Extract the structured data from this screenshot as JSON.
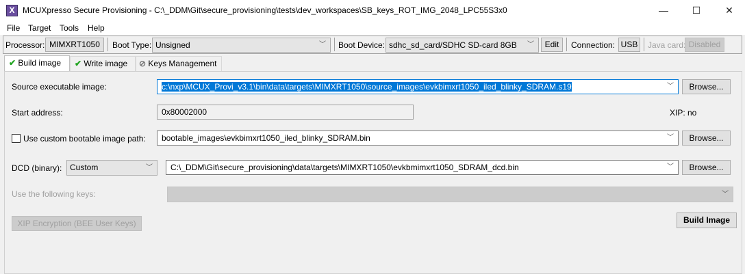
{
  "window": {
    "title": "MCUXpresso Secure Provisioning - C:\\_DDM\\Git\\secure_provisioning\\tests\\dev_workspaces\\SB_keys_ROT_IMG_2048_LPC55S3x0",
    "minimize": "—",
    "maximize": "☐",
    "close": "✕"
  },
  "menu": [
    "File",
    "Target",
    "Tools",
    "Help"
  ],
  "toolbar": {
    "processor_label": "Processor:",
    "processor_value": "MIMXRT1050",
    "boot_type_label": "Boot Type:",
    "boot_type_value": "Unsigned",
    "boot_device_label": "Boot Device:",
    "boot_device_value": "sdhc_sd_card/SDHC SD-card 8GB",
    "edit": "Edit",
    "connection_label": "Connection:",
    "connection_value": "USB",
    "java_card_label": "Java card:",
    "java_card_value": "Disabled"
  },
  "tabs": [
    {
      "label": "Build image",
      "status": "ok"
    },
    {
      "label": "Write image",
      "status": "ok"
    },
    {
      "label": "Keys Management",
      "status": "disabled"
    }
  ],
  "build": {
    "source_label": "Source executable image:",
    "source_value": "c:\\nxp\\MCUX_Provi_v3.1\\bin\\data\\targets\\MIMXRT1050\\source_images\\evkbimxrt1050_iled_blinky_SDRAM.s19",
    "browse": "Browse...",
    "start_label": "Start address:",
    "start_value": "0x80002000",
    "xip": "XIP: no",
    "custom_label": "Use custom bootable image path:",
    "custom_checked": false,
    "custom_value": "bootable_images\\evkbimxrt1050_iled_blinky_SDRAM.bin",
    "dcd_label": "DCD (binary):",
    "dcd_mode": "Custom",
    "dcd_value": "C:\\_DDM\\Git\\secure_provisioning\\data\\targets\\MIMXRT1050\\evkbmimxrt1050_SDRAM_dcd.bin",
    "keys_label": "Use the following keys:",
    "keys_value": "",
    "xip_button": "XIP Encryption (BEE User Keys)",
    "build_button": "Build Image"
  }
}
